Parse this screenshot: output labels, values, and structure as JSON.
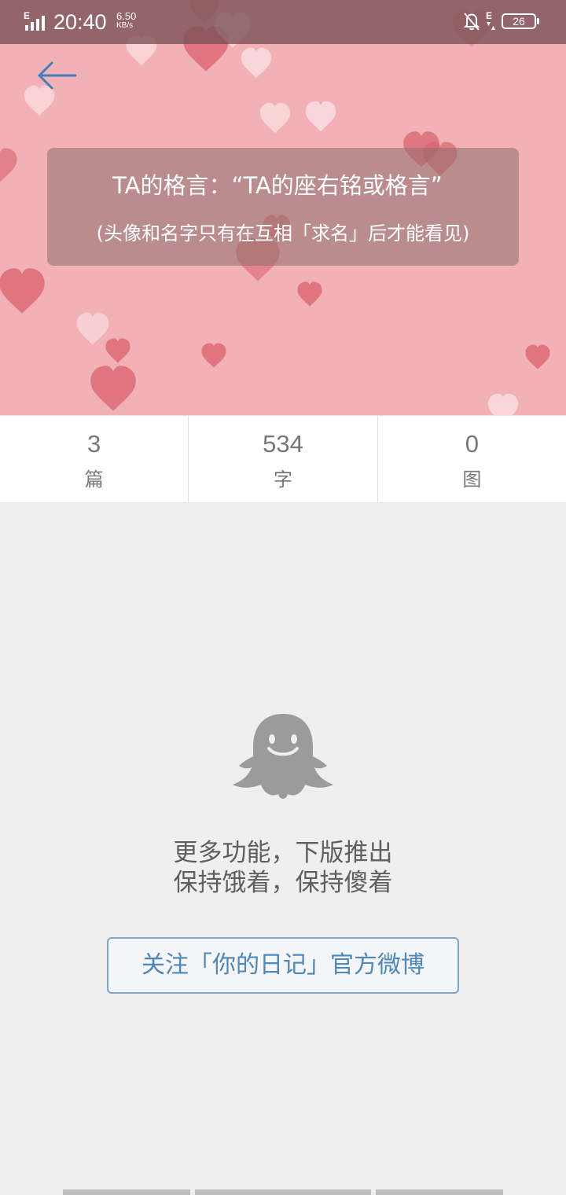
{
  "status_bar": {
    "network_type": "E",
    "time": "20:40",
    "speed_value": "6.50",
    "speed_unit": "KB/s",
    "secondary_network": "E",
    "battery": "26"
  },
  "header": {
    "back_icon": "arrow-left-icon",
    "background_color": "#f2b1b6"
  },
  "motto": {
    "line1": "TA的格言：“TA的座右铭或格言”",
    "line2": "(头像和名字只有在互相「求名」后才能看见)"
  },
  "stats": [
    {
      "value": "3",
      "label": "篇"
    },
    {
      "value": "534",
      "label": "字"
    },
    {
      "value": "0",
      "label": "图"
    }
  ],
  "empty_state": {
    "icon": "ghost-icon",
    "line1": "更多功能，下版推出",
    "line2": "保持饿着，保持傻着",
    "follow_button": "关注「你的日记」官方微博"
  },
  "colors": {
    "accent": "#4f87b8",
    "page_background": "#efefef",
    "heart_dark": "#e0737f",
    "heart_light": "#fbe3e6"
  }
}
